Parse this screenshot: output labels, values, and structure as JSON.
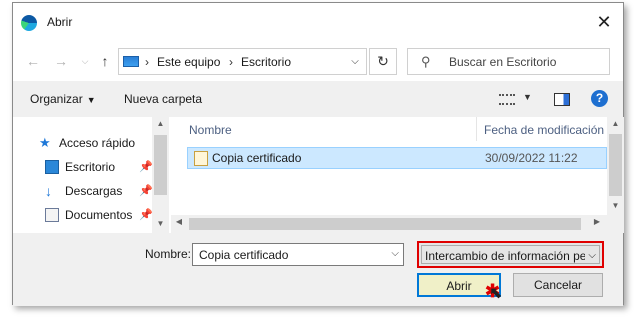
{
  "window": {
    "title": "Abrir",
    "close_icon": "close-icon",
    "app_icon": "edge-icon"
  },
  "nav": {
    "back_icon": "back-arrow-icon",
    "forward_icon": "forward-arrow-icon",
    "history_icon": "chevron-down-icon",
    "up_icon": "up-arrow-icon",
    "breadcrumbs": [
      "Este equipo",
      "Escritorio"
    ],
    "search_placeholder": "Buscar en Escritorio"
  },
  "toolbar": {
    "organize_label": "Organizar",
    "new_folder_label": "Nueva carpeta"
  },
  "sidebar": {
    "items": [
      {
        "label": "Acceso rápido",
        "icon": "star-icon",
        "pinned": false
      },
      {
        "label": "Escritorio",
        "icon": "desktop-folder-icon",
        "pinned": true
      },
      {
        "label": "Descargas",
        "icon": "download-icon",
        "pinned": true
      },
      {
        "label": "Documentos",
        "icon": "documents-icon",
        "pinned": true
      }
    ]
  },
  "files": {
    "columns": [
      "Nombre",
      "Fecha de modificación"
    ],
    "rows": [
      {
        "name": "Copia certificado",
        "modified": "30/09/2022 11:22",
        "icon": "certificate-file-icon",
        "selected": true
      }
    ]
  },
  "footer": {
    "filename_label": "Nombre:",
    "filename_value": "Copia certificado",
    "filetype_value": "Intercambio de información pe",
    "open_label": "Abrir",
    "cancel_label": "Cancelar"
  },
  "colors": {
    "selection": "#cce8ff",
    "highlight_border": "#e00000",
    "accent": "#0078d7"
  }
}
